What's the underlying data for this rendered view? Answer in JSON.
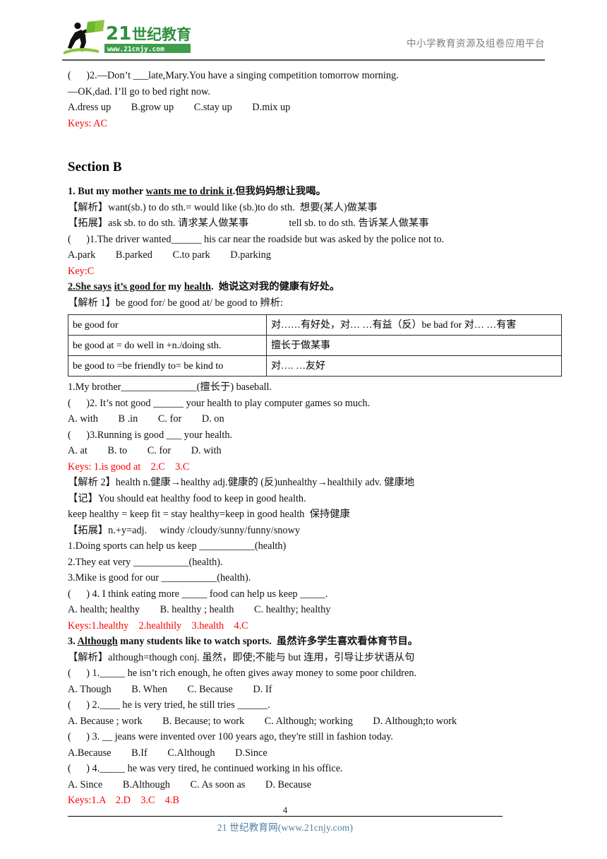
{
  "header": {
    "logo_name": "21cnjy-logo",
    "logo_brand_cn": "21世纪教育",
    "logo_brand_num": "21",
    "logo_url": "www.21cnjy.com",
    "tagline": "中小学教育资源及组卷应用平台",
    "brand_green": "#3f9c4b",
    "brand_dark_green": "#2f7a3a"
  },
  "top_question": {
    "stem": "(      )2.—Don’t ___late,Mary.You have a singing competition tomorrow morning.",
    "reply": "—OK,dad. I’ll go to bed right now.",
    "options": "A.dress up        B.grow up        C.stay up        D.mix up",
    "keys": "Keys: AC"
  },
  "section": {
    "title": "Section B"
  },
  "item1": {
    "heading_a": "1. But my mother ",
    "heading_u": "wants me to drink it",
    "heading_b": ".但我妈妈想让我喝。",
    "analysis": "【解析】want(sb.) to do sth.= would like (sb.)to do sth.  想要(某人)做某事",
    "extension": "【拓展】ask sb. to do sth. 请求某人做某事                tell sb. to do sth. 告诉某人做某事",
    "q1": "(      )1.The driver wanted______ his car near the roadside but was asked by the police not to.",
    "q1_options": "A.park        B.parked        C.to park        D.parking",
    "key": "Key:C"
  },
  "item2": {
    "heading_a": "2.She says",
    "heading_u1": "it’s good for",
    "heading_mid": " my ",
    "heading_u2": "health",
    "heading_b": ".  她说这对我的健康有好处。",
    "analysis": "【解析 1】be good for/ be good at/ be good to 辨析:",
    "table": {
      "rows": [
        {
          "term": "be good for",
          "meaning": "对……有好处，对… …有益（反）be bad for  对… …有害"
        },
        {
          "term": "be good at = do well in +n./doing sth.",
          "meaning": "擅长于做某事"
        },
        {
          "term": "be good to =be friendly to= be kind to",
          "meaning": "对…. …友好"
        }
      ]
    },
    "p1": "1.My brother_______________(擅长于) baseball.",
    "q2": "(      )2. It’s not good ______ your health to play computer games so much.",
    "q2_options": "A. with        B .in        C. for        D. on",
    "q3": "(      )3.Running is good ___ your health.",
    "q3_options": "A. at        B. to        C. for        D. with",
    "keys": "Keys: 1.is good at    2.C    3.C",
    "analysis2": "【解析 2】health n.健康→healthy adj.健康的 (反)unhealthy→healthily adv. 健康地",
    "memo": "【记】You should eat healthy food to keep in good health.",
    "memo2": "keep healthy = keep fit = stay healthy=keep in good health  保持健康",
    "extension": "【拓展】n.+y=adj.     windy /cloudy/sunny/funny/snowy",
    "p2": "1.Doing sports can help us keep ___________(health)",
    "p3": "2.They eat very ___________(health).",
    "p4": "3.Mike is good for our ___________(health).",
    "q4": "(      ) 4. I think eating more _____ food can help us keep _____.",
    "q4_options": "A. health; healthy        B. healthy ; health        C. healthy; healthy",
    "keys2": "Keys:1.healthy    2.healthily    3.health    4.C"
  },
  "item3": {
    "heading_a": "3. ",
    "heading_u": "Although",
    "heading_b": " many students like to watch sports.  虽然许多学生喜欢看体育节目。",
    "analysis": "【解析】although=though conj. 虽然，即使;不能与 but 连用，引导让步状语从句",
    "q1": "(      ) 1._____ he isn’t rich enough, he often gives away money to some poor children.",
    "q1_options": "A. Though        B. When        C. Because        D. If",
    "q2": "(      ) 2.____ he is very tried, he still tries ______.",
    "q2_options": "A. Because ; work        B. Because; to work        C. Although; working        D. Although;to work",
    "q3": "(      ) 3. __ jeans were invented over 100 years ago, they're still in fashion today.",
    "q3_options": "A.Because        B.If        C.Although        D.Since",
    "q4": "(      ) 4._____ he was very tired, he continued working in his office.",
    "q4_options": "A. Since        B.Although        C. As soon as        D. Because",
    "keys": "Keys:1.A    2.D    3.C    4.B"
  },
  "footer": {
    "page_number": "4",
    "text": "21 世纪教育网(www.21cnjy.com)"
  }
}
